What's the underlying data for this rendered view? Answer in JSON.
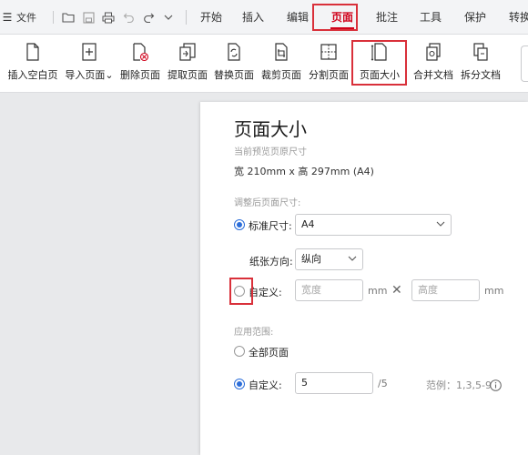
{
  "topbar": {
    "menu_icon": "☰",
    "file_label": "文件",
    "tabs": [
      {
        "label": "开始"
      },
      {
        "label": "插入"
      },
      {
        "label": "编辑"
      },
      {
        "label": "页面"
      },
      {
        "label": "批注"
      },
      {
        "label": "工具"
      },
      {
        "label": "保护"
      },
      {
        "label": "转换"
      }
    ],
    "active_tab": "页面",
    "accent_color": "#d0021b"
  },
  "ribbon": {
    "items": [
      {
        "label": "插入空白页",
        "icon": "blank-page-icon"
      },
      {
        "label": "导入页面",
        "icon": "import-page-icon"
      },
      {
        "label": "删除页面",
        "icon": "delete-page-icon"
      },
      {
        "label": "提取页面",
        "icon": "extract-page-icon"
      },
      {
        "label": "替换页面",
        "icon": "replace-page-icon"
      },
      {
        "label": "裁剪页面",
        "icon": "crop-page-icon"
      },
      {
        "label": "分割页面",
        "icon": "split-page-icon"
      },
      {
        "label": "页面大小",
        "icon": "page-size-icon"
      },
      {
        "label": "合并文档",
        "icon": "merge-doc-icon"
      },
      {
        "label": "拆分文档",
        "icon": "split-doc-icon"
      }
    ]
  },
  "panel": {
    "title": "页面大小",
    "current_label": "当前预览页原尺寸",
    "current_size": "宽 210mm x 高 297mm (A4)",
    "adjust_label": "调整后页面尺寸:",
    "standard_label": "标准尺寸:",
    "standard_value": "A4",
    "orientation_label": "纸张方向:",
    "orientation_value": "纵向",
    "custom_label": "自定义:",
    "width_placeholder": "宽度",
    "height_placeholder": "高度",
    "unit": "mm",
    "times": "✕",
    "range_label": "应用范围:",
    "all_pages_label": "全部页面",
    "range_custom_label": "自定义:",
    "range_value": "5",
    "range_total": "/5",
    "range_example": "范例：1,3,5-9",
    "info_icon": "info-icon",
    "radio_color": "#2b6dd9"
  }
}
